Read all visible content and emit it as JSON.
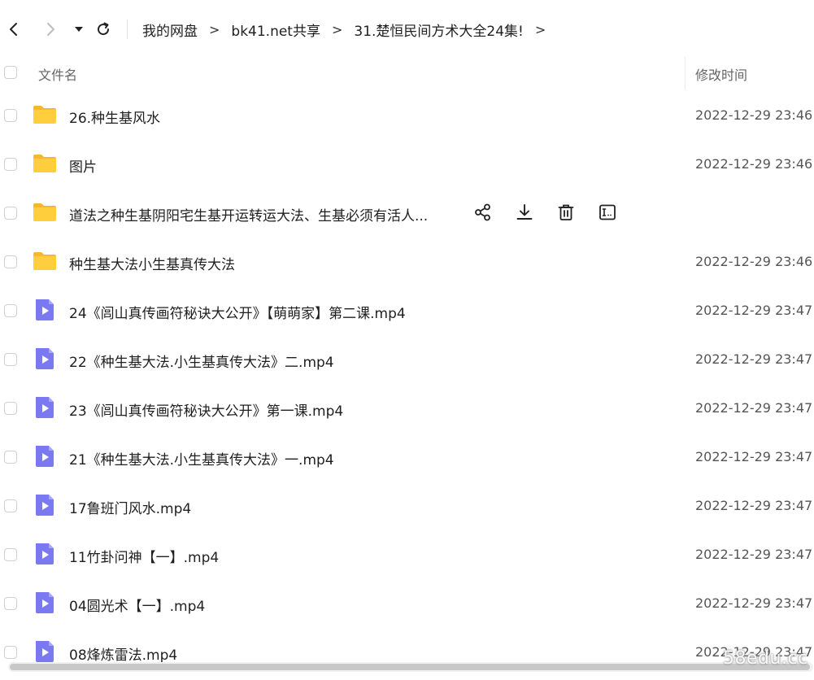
{
  "nav": {
    "back_icon": "chevron-left-icon",
    "forward_icon": "chevron-right-icon",
    "dropdown_icon": "caret-down-icon",
    "refresh_icon": "refresh-icon"
  },
  "breadcrumb": {
    "items": [
      "我的网盘",
      "bk41.net共享",
      "31.楚恒民间方术大全24集!"
    ],
    "separator": ">"
  },
  "table": {
    "columns": {
      "name": "文件名",
      "modified": "修改时间"
    },
    "rows": [
      {
        "type": "folder",
        "name": "26.种生基风水",
        "time": "2022-12-29 23:46"
      },
      {
        "type": "folder",
        "name": "图片",
        "time": "2022-12-29 23:46"
      },
      {
        "type": "folder",
        "name": "道法之种生基阴阳宅生基开运转运大法、生基必须有活人...",
        "time": ""
      },
      {
        "type": "folder",
        "name": "种生基大法小生基真传大法",
        "time": "2022-12-29 23:46"
      },
      {
        "type": "video",
        "name": "24《闾山真传画符秘诀大公开》【萌萌家】第二课.mp4",
        "time": "2022-12-29 23:47"
      },
      {
        "type": "video",
        "name": "22《种生基大法.小生基真传大法》二.mp4",
        "time": "2022-12-29 23:47"
      },
      {
        "type": "video",
        "name": "23《闾山真传画符秘诀大公开》第一课.mp4",
        "time": "2022-12-29 23:47"
      },
      {
        "type": "video",
        "name": "21《种生基大法.小生基真传大法》一.mp4",
        "time": "2022-12-29 23:47"
      },
      {
        "type": "video",
        "name": "17鲁班门风水.mp4",
        "time": "2022-12-29 23:47"
      },
      {
        "type": "video",
        "name": "11竹卦问神【一】.mp4",
        "time": "2022-12-29 23:47"
      },
      {
        "type": "video",
        "name": "04圆光术【一】.mp4",
        "time": "2022-12-29 23:47"
      },
      {
        "type": "video",
        "name": "08烽炼雷法.mp4",
        "time": "2022-12-29 23:47"
      }
    ],
    "hover_actions": [
      "share-icon",
      "download-icon",
      "delete-icon",
      "rename-icon"
    ]
  },
  "colors": {
    "folder": "#FFCE3D",
    "folder_tab": "#F7B731",
    "video": "#7B79F2",
    "video_fold": "#A9A7F7"
  },
  "watermark": "58edu.cc"
}
